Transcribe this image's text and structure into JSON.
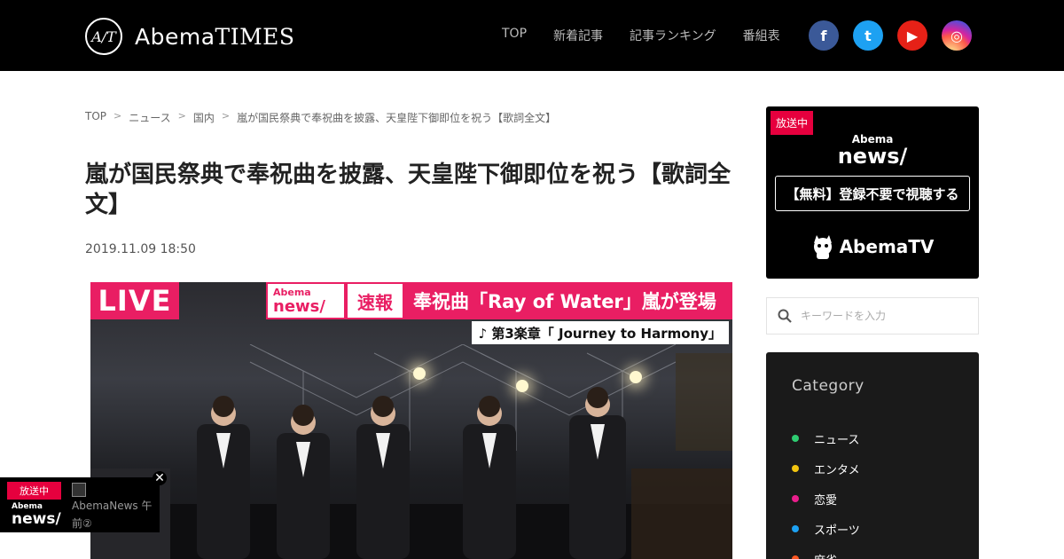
{
  "header": {
    "logo_mark": "A/T",
    "logo_word": "Abema",
    "logo_times": "TIMES",
    "nav": [
      "TOP",
      "新着記事",
      "記事ランキング",
      "番組表"
    ],
    "social": [
      {
        "name": "facebook",
        "glyph": "f"
      },
      {
        "name": "twitter",
        "glyph": "t"
      },
      {
        "name": "youtube",
        "glyph": "▶"
      },
      {
        "name": "instagram",
        "glyph": "◎"
      }
    ]
  },
  "breadcrumb": [
    "TOP",
    "ニュース",
    "国内",
    "嵐が国民祭典で奉祝曲を披露、天皇陛下御即位を祝う【歌詞全文】"
  ],
  "article": {
    "title": "嵐が国民祭典で奉祝曲を披露、天皇陛下御即位を祝う【歌詞全文】",
    "date": "2019.11.09 18:50",
    "hero": {
      "live_label": "LIVE",
      "news_logo_small": "Abema",
      "news_logo_big": "news/",
      "flash_label": "速報",
      "headline": "奉祝曲「Ray of Water」嵐が登場",
      "sub_caption": "♪ 第3楽章「 Journey  to Harmony」"
    }
  },
  "sidebar": {
    "onair_label": "放送中",
    "channel_small": "Abema",
    "channel_big": "news/",
    "signup_label": "【無料】登録不要で視聴する",
    "abematv_label": "AbemaTV",
    "search_placeholder": "キーワードを入力",
    "category_title": "Category",
    "categories": [
      {
        "label": "ニュース",
        "color": "#2ecc71"
      },
      {
        "label": "エンタメ",
        "color": "#f1c40f"
      },
      {
        "label": "恋愛",
        "color": "#e91e8c"
      },
      {
        "label": "スポーツ",
        "color": "#1da1f2"
      },
      {
        "label": "麻雀",
        "color": "#ff5722"
      }
    ]
  },
  "mini_player": {
    "onair_label": "放送中",
    "logo_small": "Abema",
    "logo_big": "news/",
    "program": "AbemaNews 午前②",
    "close_glyph": "✕"
  },
  "colors": {
    "header_bg": "#000000",
    "live_pink": "#e91e63",
    "onair_red": "#e6003e"
  }
}
